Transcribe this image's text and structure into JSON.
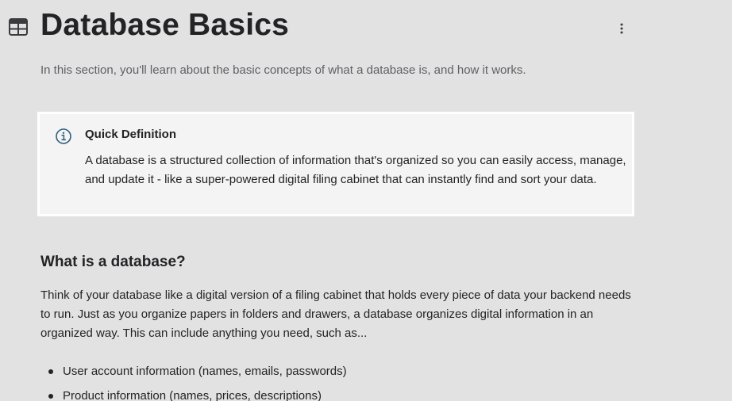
{
  "header": {
    "icon": "table-icon",
    "title": "Database Basics",
    "menu_icon": "more-vertical-icon"
  },
  "intro": {
    "text": "In this section, you'll learn about the basic concepts of what a database is, and how it works."
  },
  "callout": {
    "icon": "info-icon",
    "title": "Quick Definition",
    "body": "A database is a structured collection of information that's organized so you can easily access, manage, and update it - like a super-powered digital filing cabinet that can instantly find and sort your data."
  },
  "section": {
    "heading": "What is a database?",
    "paragraph": "Think of your database like a digital version of a filing cabinet that holds every piece of data your backend needs to run. Just as you organize papers in folders and drawers, a database organizes digital information in an organized way. This can include anything you need, such as...",
    "bullets": [
      "User account information (names, emails, passwords)",
      "Product information (names, prices, descriptions)"
    ]
  },
  "colors": {
    "background": "#e2e2e2",
    "callout_background": "#f4f4f4",
    "callout_border": "#ffffff",
    "info_icon": "#2f5f7e",
    "text": "#232326",
    "muted_text": "#5f5f66"
  }
}
